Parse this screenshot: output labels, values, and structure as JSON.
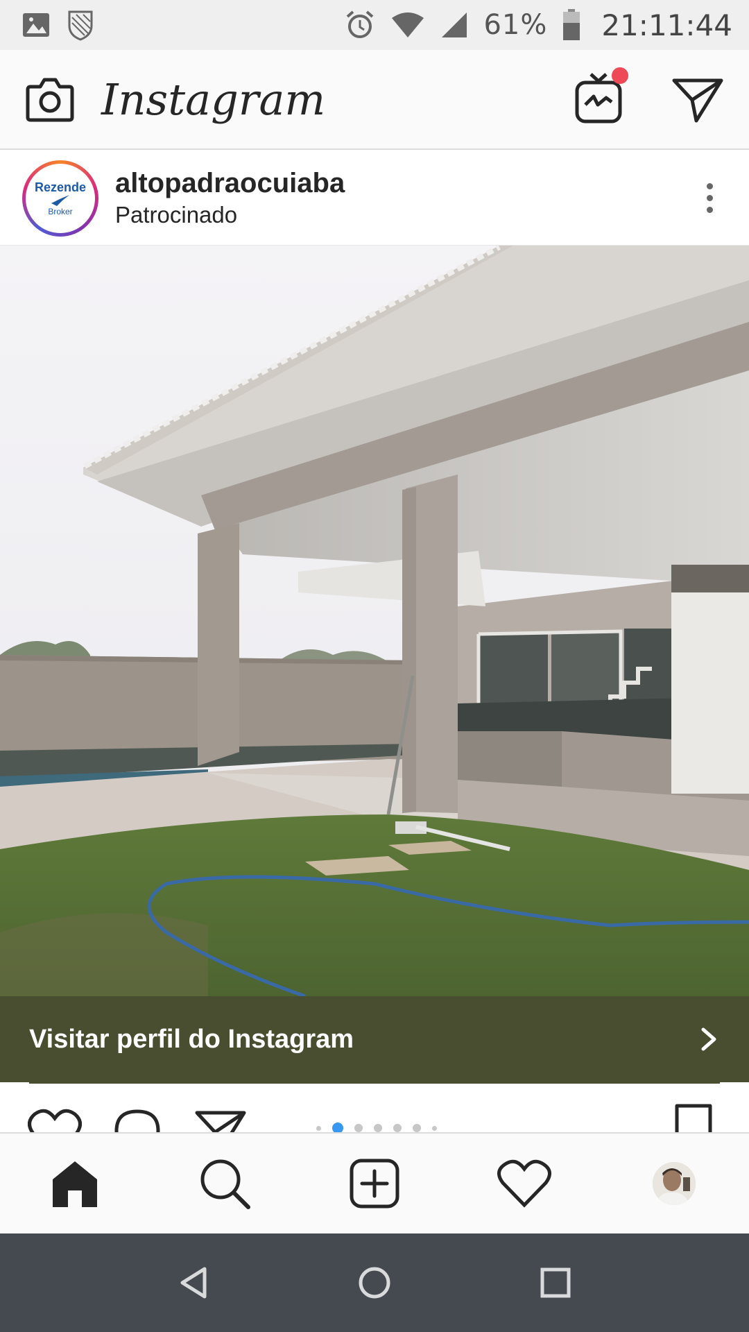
{
  "status_bar": {
    "battery": "61%",
    "time": "21:11:44",
    "icons": [
      "image-icon",
      "shield-icon",
      "alarm-icon",
      "wifi-icon",
      "signal-icon",
      "battery-icon"
    ]
  },
  "header": {
    "brand": "Instagram",
    "icons": [
      "camera-icon",
      "igtv-icon",
      "direct-message-icon"
    ],
    "notification_color": "#ed4956"
  },
  "post": {
    "username": "altopadraocuiaba",
    "sponsored_label": "Patrocinado",
    "avatar": {
      "logo_text": "Rezende",
      "logo_sub": "Broker"
    },
    "cta_label": "Visitar perfil do Instagram",
    "cta_color": "#4a4e31",
    "carousel": {
      "total": 7,
      "active_index": 1
    }
  },
  "bottom_nav": {
    "items": [
      "home-icon",
      "search-icon",
      "new-post-icon",
      "activity-icon",
      "profile-avatar"
    ]
  },
  "android_nav": {
    "items": [
      "back-button",
      "home-button",
      "recents-button"
    ]
  },
  "colors": {
    "accent_blue": "#3897f0",
    "text": "#262626"
  }
}
